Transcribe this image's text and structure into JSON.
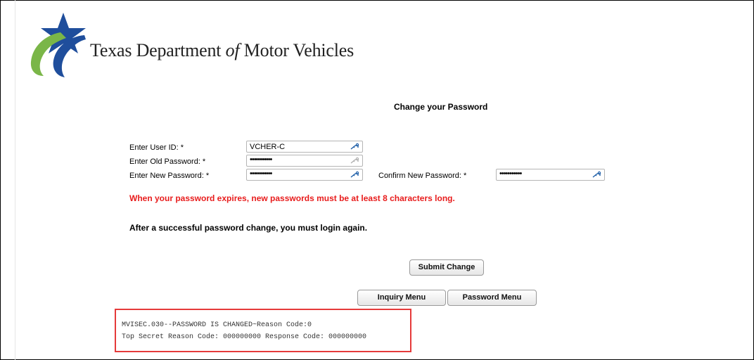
{
  "brand": {
    "prefix": "Texas Department ",
    "of": "of",
    "suffix": " Motor Vehicles"
  },
  "form": {
    "title": "Change your Password",
    "user_id_label": "Enter User ID: *",
    "user_id_value": "VCHER-C",
    "old_password_label": "Enter Old Password: *",
    "old_password_mask": "•••••••••••",
    "new_password_label": "Enter New Password: *",
    "new_password_mask": "•••••••••••",
    "confirm_password_label": "Confirm New Password: *",
    "confirm_password_mask": "•••••••••••"
  },
  "notices": {
    "warning": "When your password expires, new passwords must be at least 8 characters long.",
    "info": "After a successful password change, you must login again."
  },
  "buttons": {
    "submit": "Submit Change",
    "inquiry_menu": "Inquiry Menu",
    "password_menu": "Password Menu"
  },
  "status": {
    "line1": "MVISEC.030--PASSWORD IS CHANGED~Reason Code:0",
    "line2": "Top Secret Reason Code: 000000000 Response Code: 000000000"
  },
  "colors": {
    "warning": "#e81c1c",
    "status_border": "#e53a3a",
    "logo_blue": "#1f4e9c",
    "logo_green": "#7ab648",
    "key_icon": "#1f5fa8"
  },
  "icons": [
    "txdmv-logo",
    "key-icon"
  ]
}
